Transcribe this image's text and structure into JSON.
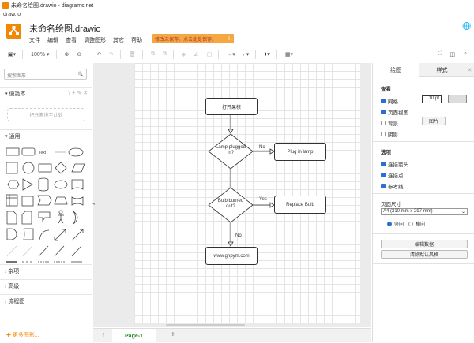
{
  "window": {
    "title": "未命名绘图.drawio - diagrams.net",
    "url": "draw.io"
  },
  "header": {
    "doc_title": "未命名绘图.drawio",
    "menu": [
      "文件",
      "编辑",
      "查看",
      "调整图形",
      "其它",
      "帮助"
    ],
    "unsaved_notice": "修改未保存。点击此处保存。"
  },
  "toolbar": {
    "zoom": "100%"
  },
  "sidebar": {
    "search_placeholder": "搜索图形",
    "scratchpad": "便笺本",
    "scratch_tools": "? + ✎ ✕",
    "scratch_drop": "把元素拖至此处",
    "general": "通用",
    "text_shape": "Text",
    "sections": [
      "杂项",
      "高级",
      "流程图"
    ],
    "more_shapes": "更多图形..."
  },
  "diagram": {
    "start": "打开果核",
    "d1": "Lamp plugged in?",
    "d1_no": "No",
    "plug": "Plug in lamp",
    "d2": "Bulb burned out?",
    "d2_yes": "Yes",
    "replace": "Replace Bulb",
    "d2_no": "No",
    "end": "www.ghpym.com"
  },
  "pages": {
    "tab": "Page-1",
    "add": "+"
  },
  "panel": {
    "tabs": [
      "绘图",
      "样式"
    ],
    "view_heading": "查看",
    "grid": "网格",
    "grid_size": "10 pt",
    "page_view": "页面视图",
    "background": "背景",
    "shadow": "阴影",
    "image_btn": "图片",
    "options_heading": "选项",
    "connection_arrows": "连接箭头",
    "connection_points": "连接点",
    "guides": "参考线",
    "paper_heading": "页面尺寸",
    "paper_size": "A4 (210 mm x 297 mm)",
    "portrait": "竖向",
    "landscape": "横向",
    "edit_data": "编辑数据",
    "clear_style": "清除默认风格"
  }
}
